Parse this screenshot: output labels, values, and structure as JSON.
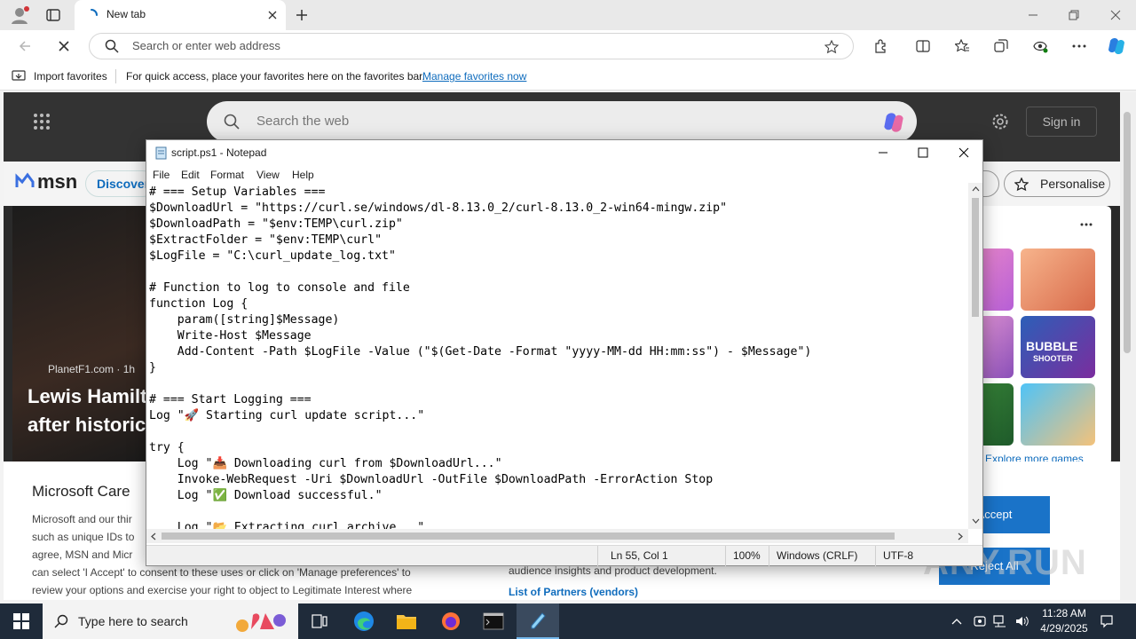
{
  "browser": {
    "tab_title": "New tab",
    "address_placeholder": "Search or enter web address",
    "favorites_bar": {
      "import_label": "Import favorites",
      "message": "For quick access, place your favorites here on the favorites bar.",
      "manage_link": "Manage favorites now"
    }
  },
  "msn": {
    "search_placeholder": "Search the web",
    "sign_in": "Sign in",
    "logo": "msn",
    "discover": "Discover",
    "personalise": "Personalise",
    "news_source": "PlanetF1.com · 1h",
    "headline_line1": "Lewis Hamilt",
    "headline_line2": "after historic",
    "explore_games": "Explore more games",
    "bubble_line1": "BUBBLE",
    "bubble_line2": "SHOOTER",
    "consent_title": "Microsoft Care",
    "consent_text_lines": [
      "Microsoft and our thir",
      "such as unique IDs to",
      "agree, MSN and Micr",
      "can select 'I Accept' to consent to these uses or click on 'Manage preferences' to",
      "review your options and exercise your right to object to Legitimate Interest where"
    ],
    "consent_right_text": "audience insights and product development.",
    "partners_link": "List of Partners (vendors)",
    "accept": "Accept",
    "reject_all": "Reject All"
  },
  "notepad": {
    "title": "script.ps1 - Notepad",
    "menu": [
      "File",
      "Edit",
      "Format",
      "View",
      "Help"
    ],
    "code_lines": [
      "# === Setup Variables ===",
      "$DownloadUrl = \"https://curl.se/windows/dl-8.13.0_2/curl-8.13.0_2-win64-mingw.zip\"",
      "$DownloadPath = \"$env:TEMP\\curl.zip\"",
      "$ExtractFolder = \"$env:TEMP\\curl\"",
      "$LogFile = \"C:\\curl_update_log.txt\"",
      "",
      "# Function to log to console and file",
      "function Log {",
      "    param([string]$Message)",
      "    Write-Host $Message",
      "    Add-Content -Path $LogFile -Value (\"$(Get-Date -Format \"yyyy-MM-dd HH:mm:ss\") - $Message\")",
      "}",
      "",
      "# === Start Logging ===",
      "Log \"🚀 Starting curl update script...\"",
      "",
      "try {",
      "    Log \"📥 Downloading curl from $DownloadUrl...\"",
      "    Invoke-WebRequest -Uri $DownloadUrl -OutFile $DownloadPath -ErrorAction Stop",
      "    Log \"✅ Download successful.\"",
      "",
      "    Log \"📂 Extracting curl archive...\""
    ],
    "status": {
      "position": "Ln 55, Col 1",
      "zoom": "100%",
      "line_ending": "Windows (CRLF)",
      "encoding": "UTF-8"
    }
  },
  "taskbar": {
    "search_placeholder": "Type here to search",
    "time": "11:28 AM",
    "date": "4/29/2025"
  },
  "watermark": "ANY.RUN",
  "colors": {
    "accent_blue": "#0f6cbd",
    "taskbar": "#1f2b3a",
    "accept_button": "#1a73c8"
  }
}
